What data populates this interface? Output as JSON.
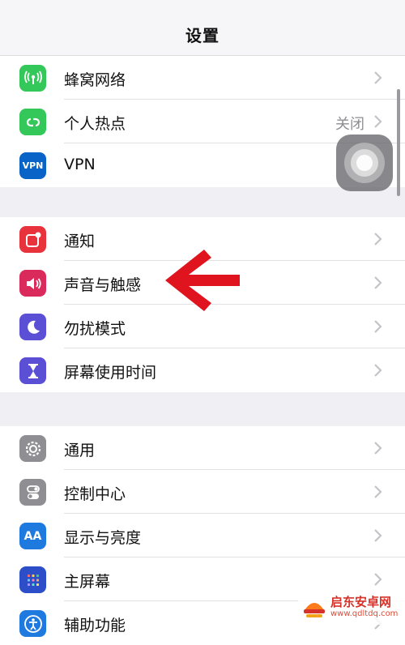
{
  "header": {
    "title": "设置"
  },
  "groups": [
    {
      "items": [
        {
          "label": "蜂窝网络",
          "icon": "cellular-icon",
          "color": "#34c759"
        },
        {
          "label": "个人热点",
          "value": "关闭",
          "icon": "hotspot-icon",
          "color": "#34c759"
        },
        {
          "label": "VPN",
          "icon": "vpn-icon",
          "icon_text": "VPN",
          "color": "#0a64c8"
        }
      ]
    },
    {
      "items": [
        {
          "label": "通知",
          "icon": "notifications-icon",
          "color": "#e8333c"
        },
        {
          "label": "声音与触感",
          "icon": "sound-icon",
          "color": "#d92a5b"
        },
        {
          "label": "勿扰模式",
          "icon": "moon-icon",
          "color": "#5b4fd6"
        },
        {
          "label": "屏幕使用时间",
          "icon": "hourglass-icon",
          "color": "#5b4fd6"
        }
      ]
    },
    {
      "items": [
        {
          "label": "通用",
          "icon": "gear-icon",
          "color": "#8e8e93"
        },
        {
          "label": "控制中心",
          "icon": "control-center-icon",
          "color": "#8e8e93"
        },
        {
          "label": "显示与亮度",
          "icon": "display-icon",
          "icon_text": "AA",
          "color": "#1f7ae0"
        },
        {
          "label": "主屏幕",
          "icon": "home-screen-icon",
          "color": "#2c4fc9"
        },
        {
          "label": "辅助功能",
          "icon": "accessibility-icon",
          "color": "#1f7ae0"
        }
      ]
    }
  ],
  "annotation": {
    "arrow_color": "#e0141e",
    "points_to": "声音与触感"
  },
  "watermark": {
    "name": "启东安卓网",
    "url": "www.qdltdq.com"
  }
}
